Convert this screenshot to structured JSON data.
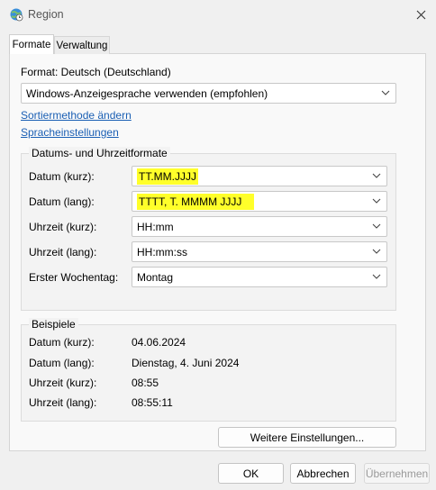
{
  "window": {
    "title": "Region"
  },
  "tabs": [
    {
      "label": "Formate"
    },
    {
      "label": "Verwaltung"
    }
  ],
  "format": {
    "label": "Format: Deutsch (Deutschland)",
    "selected": "Windows-Anzeigesprache verwenden (empfohlen)"
  },
  "links": {
    "sort": "Sortiermethode ändern",
    "language": "Spracheinstellungen"
  },
  "date_time_formats": {
    "title": "Datums- und Uhrzeitformate",
    "rows": [
      {
        "label": "Datum (kurz):",
        "value": "TT.MM.JJJJ"
      },
      {
        "label": "Datum (lang):",
        "value": "TTTT, T. MMMM JJJJ"
      },
      {
        "label": "Uhrzeit (kurz):",
        "value": "HH:mm"
      },
      {
        "label": "Uhrzeit (lang):",
        "value": "HH:mm:ss"
      },
      {
        "label": "Erster Wochentag:",
        "value": "Montag"
      }
    ]
  },
  "examples": {
    "title": "Beispiele",
    "rows": [
      {
        "label": "Datum (kurz):",
        "value": "04.06.2024"
      },
      {
        "label": "Datum (lang):",
        "value": "Dienstag, 4. Juni 2024"
      },
      {
        "label": "Uhrzeit (kurz):",
        "value": "08:55"
      },
      {
        "label": "Uhrzeit (lang):",
        "value": "08:55:11"
      }
    ]
  },
  "buttons": {
    "more_settings": "Weitere Einstellungen...",
    "ok": "OK",
    "cancel": "Abbrechen",
    "apply": "Übernehmen"
  },
  "colors": {
    "highlight": "#ffff2a",
    "link": "#1a5fb4"
  },
  "icons": {
    "app": "globe-clock-icon",
    "close": "close-icon",
    "dropdown": "chevron-down-icon"
  }
}
